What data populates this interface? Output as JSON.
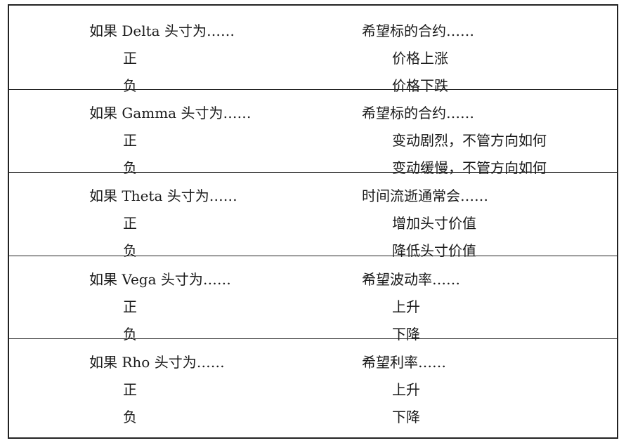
{
  "sections": [
    {
      "condition": "如果 Delta 头寸为……",
      "expectation": "希望标的合约……",
      "positive_label": "正",
      "positive_value": "价格上涨",
      "negative_label": "负",
      "negative_value": "价格下跌"
    },
    {
      "condition": "如果 Gamma 头寸为……",
      "expectation": "希望标的合约……",
      "positive_label": "正",
      "positive_value": "变动剧烈，不管方向如何",
      "negative_label": "负",
      "negative_value": "变动缓慢，不管方向如何"
    },
    {
      "condition": "如果 Theta 头寸为……",
      "expectation": "时间流逝通常会……",
      "positive_label": "正",
      "positive_value": "增加头寸价值",
      "negative_label": "负",
      "negative_value": "降低头寸价值"
    },
    {
      "condition": "如果 Vega 头寸为……",
      "expectation": "希望波动率……",
      "positive_label": "正",
      "positive_value": "上升",
      "negative_label": "负",
      "negative_value": "下降"
    },
    {
      "condition": "如果 Rho 头寸为……",
      "expectation": "希望利率……",
      "positive_label": "正",
      "positive_value": "上升",
      "negative_label": "负",
      "negative_value": "下降"
    }
  ]
}
